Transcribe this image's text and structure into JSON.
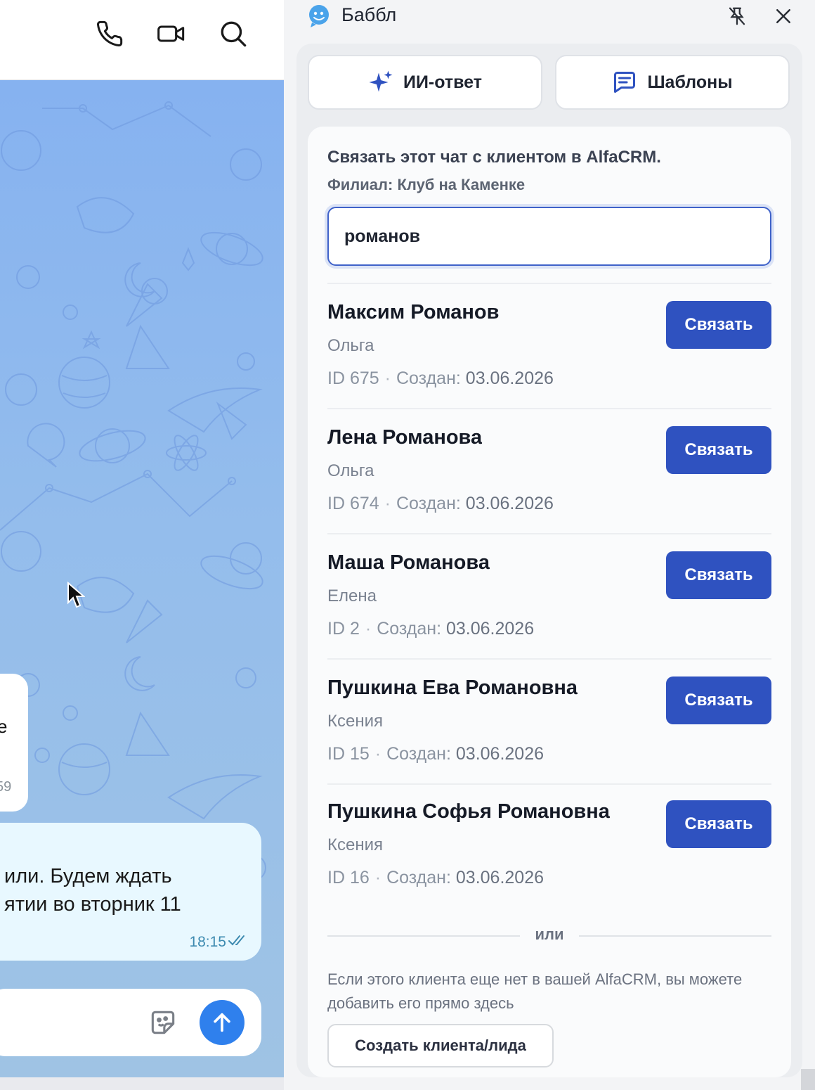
{
  "chat": {
    "incoming_fragment_text": "e",
    "incoming_fragment_time": "59",
    "outgoing_line1": "или. Будем ждать",
    "outgoing_line2": "ятии во вторник 11",
    "outgoing_time": "18:15",
    "header_icons": [
      "phone-icon",
      "video-camera-icon",
      "search-icon"
    ]
  },
  "panel": {
    "app_title": "Баббл",
    "ai_reply_label": "ИИ-ответ",
    "templates_label": "Шаблоны",
    "link_title": "Связать этот чат с клиентом в AlfaCRM.",
    "branch": "Филиал: Клуб на Каменке",
    "search_value": "романов",
    "link_button_label": "Связать",
    "created_label": "Создан:",
    "clients": [
      {
        "name": "Максим Романов",
        "manager": "Ольга",
        "id": "ID 675",
        "date": "03.06.2026"
      },
      {
        "name": "Лена Романова",
        "manager": "Ольга",
        "id": "ID 674",
        "date": "03.06.2026"
      },
      {
        "name": "Маша Романова",
        "manager": "Елена",
        "id": "ID 2",
        "date": "03.06.2026"
      },
      {
        "name": "Пушкина Ева Романовна",
        "manager": "Ксения",
        "id": "ID 15",
        "date": "03.06.2026"
      },
      {
        "name": "Пушкина Софья Романовна",
        "manager": "Ксения",
        "id": "ID 16",
        "date": "03.06.2026"
      }
    ],
    "or_label": "или",
    "hint": "Если этого клиента еще нет в вашей AlfaCRM, вы можете добавить его прямо здесь",
    "create_button_label": "Создать клиента/лида"
  },
  "colors": {
    "accent": "#2f52c0",
    "chat_bg": "#8fb8ee",
    "send_button": "#2f80ed",
    "outgoing_bubble": "#e8f8ff"
  }
}
